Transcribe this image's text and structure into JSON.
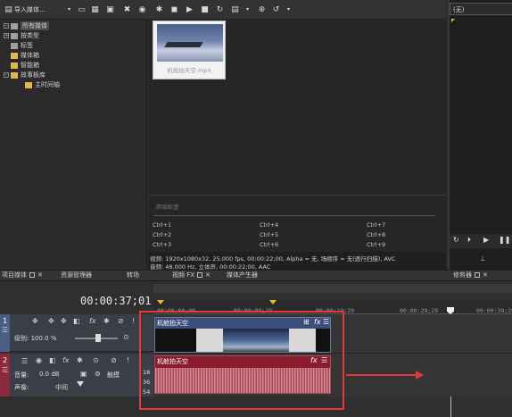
{
  "toolbar": {
    "import_label": "导入媒体...",
    "buttons": [
      "save-icon",
      "grid-icon",
      "film-icon",
      "refresh-icon",
      "remove-icon",
      "gear-icon",
      "stop-icon",
      "play-icon",
      "stop-square-icon",
      "loop-icon",
      "view-icon",
      "zoom-icon",
      "undo-icon"
    ]
  },
  "media_tree": {
    "items": [
      {
        "label": "所有媒体",
        "selected": true
      },
      {
        "label": "按类型"
      },
      {
        "label": "标签"
      },
      {
        "label": "媒体箱"
      },
      {
        "label": "智能箱"
      },
      {
        "label": "故事板库"
      },
      {
        "label": "主时间轴"
      }
    ]
  },
  "media_item": {
    "filename": "机舱拍天空.mp4"
  },
  "tag_panel": {
    "placeholder": "添加标签",
    "shortcuts": [
      "Ctrl+1",
      "Ctrl+4",
      "Ctrl+7",
      "Ctrl+2",
      "Ctrl+5",
      "Ctrl+8",
      "Ctrl+3",
      "Ctrl+6",
      "Ctrl+9"
    ]
  },
  "media_info": {
    "video_line": "视频: 1920x1080x32, 25.000 fps, 00:00:22;00, Alpha = 无, 场顺序 = 无(逐行扫描), AVC",
    "audio_line": "音频: 48,000 Hz, 立体声, 00:00:22;00, AAC"
  },
  "preview": {
    "dropdown": "(无)"
  },
  "panel_tabs": {
    "project_media": "项目媒体",
    "explorer": "资源管理器",
    "transitions": "转场",
    "video_fx": "视频 FX",
    "media_generators": "媒体产生器",
    "trimmer": "修剪器"
  },
  "timeline": {
    "timecode": "00:00:37;01",
    "ruler_labels": [
      "00:00:00;00",
      "00:00:09;29",
      "00:00:19;29",
      "00:00:29;29",
      "00:00:39;29"
    ],
    "video_track": {
      "number": "1",
      "level_label": "级别: 100.0 %",
      "level_value": 100
    },
    "audio_track": {
      "number": "2",
      "volume_label": "音量:",
      "volume_value": "0.0 dB",
      "pan_label": "声像:",
      "pan_value": "中间",
      "touch_label": "触摸"
    },
    "video_clip": {
      "title": "机舱拍天空"
    },
    "audio_clip": {
      "title": "机舱拍天空"
    },
    "meter_labels": [
      "18",
      "36",
      "54"
    ]
  },
  "colors": {
    "accent_red": "#e53935",
    "clip_video": "#3b4d7a",
    "clip_audio": "#8a1c2e",
    "yellow": "#e0c020"
  }
}
